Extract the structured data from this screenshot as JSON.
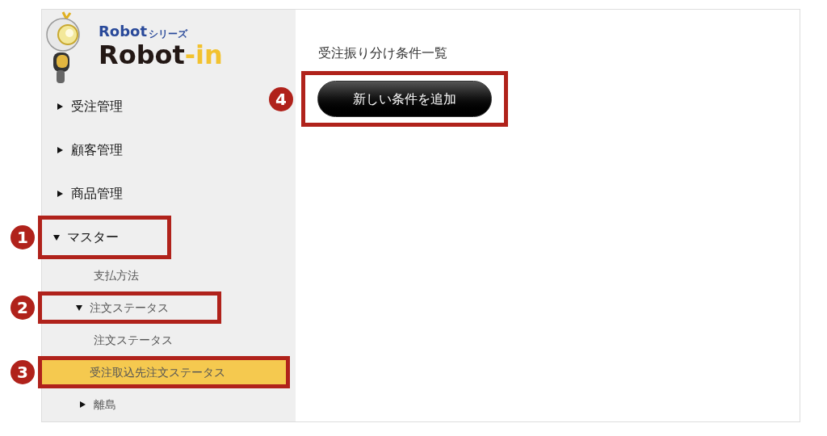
{
  "logo": {
    "series_brand": "Robot",
    "series_label": "シリーズ",
    "name": "Robot",
    "name_suffix": "-in"
  },
  "menu": [
    {
      "label": "受注管理",
      "expanded": false,
      "selected": false
    },
    {
      "label": "顧客管理",
      "expanded": false,
      "selected": false
    },
    {
      "label": "商品管理",
      "expanded": false,
      "selected": false
    },
    {
      "label": "マスター",
      "expanded": true,
      "selected": false,
      "annotation": "1",
      "children": [
        {
          "label": "支払方法",
          "selected": false
        },
        {
          "label": "注文ステータス",
          "expanded": true,
          "selected": false,
          "annotation": "2",
          "children": [
            {
              "label": "注文ステータス",
              "selected": false
            },
            {
              "label": "受注取込先注文ステータス",
              "selected": true,
              "annotation": "3"
            }
          ]
        },
        {
          "label": "離島",
          "expanded": false,
          "selected": false
        }
      ]
    }
  ],
  "main": {
    "title": "受注振り分け条件一覧",
    "button": {
      "label": "新しい条件を追加",
      "annotation": "4"
    }
  }
}
